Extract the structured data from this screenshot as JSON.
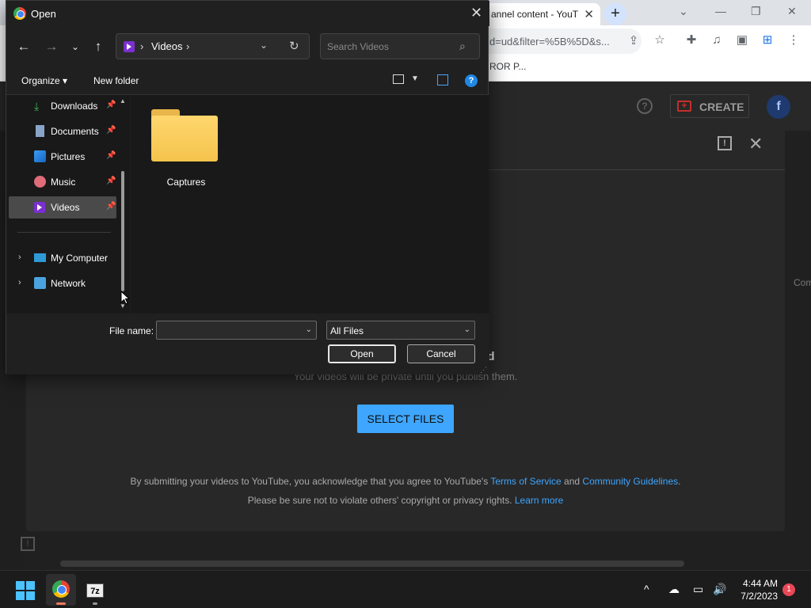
{
  "browser": {
    "tab_title": "annel content - YouT",
    "url": "d=ud&filter=%5B%5D&s...",
    "bookmark_text": "ROR P..."
  },
  "dialog": {
    "title": "Open",
    "path_folder": "Videos",
    "search_placeholder": "Search Videos",
    "organize_label": "Organize",
    "new_folder_label": "New folder",
    "nav_items": [
      {
        "label": "Downloads",
        "icon": "download-icon"
      },
      {
        "label": "Documents",
        "icon": "document-icon"
      },
      {
        "label": "Pictures",
        "icon": "pictures-icon"
      },
      {
        "label": "Music",
        "icon": "music-icon"
      },
      {
        "label": "Videos",
        "icon": "video-icon"
      },
      {
        "label": "My Computer",
        "icon": "computer-icon"
      },
      {
        "label": "Network",
        "icon": "network-icon"
      }
    ],
    "selected_nav": "Videos",
    "folder_name": "Captures",
    "file_name_label": "File name:",
    "file_name_value": "",
    "file_type": "All Files",
    "open_label": "Open",
    "cancel_label": "Cancel"
  },
  "youtube": {
    "create_label": "CREATE",
    "avatar_letter": "f",
    "upload_title": "d",
    "upload_subtitle": "Your videos will be private until you publish them.",
    "select_files_label": "SELECT FILES",
    "legal_line1_prefix": "By submitting your videos to YouTube, you acknowledge that you agree to YouTube's ",
    "terms_link": "Terms of Service",
    "legal_and": " and ",
    "guidelines_link": "Community Guidelines",
    "legal_period": ".",
    "legal_line2_prefix": "Please be sure not to violate others' copyright or privacy rights. ",
    "learn_more_link": "Learn more",
    "side_text": "Com"
  },
  "taskbar": {
    "time": "4:44 AM",
    "date": "7/2/2023",
    "notification_count": "1",
    "sevenzip_label": "7z"
  },
  "colors": {
    "accent": "#3ea6ff",
    "brand_red": "#c4302b",
    "folder_yellow": "#f4c34c",
    "selected_nav_bg": "#4a4a4a"
  }
}
